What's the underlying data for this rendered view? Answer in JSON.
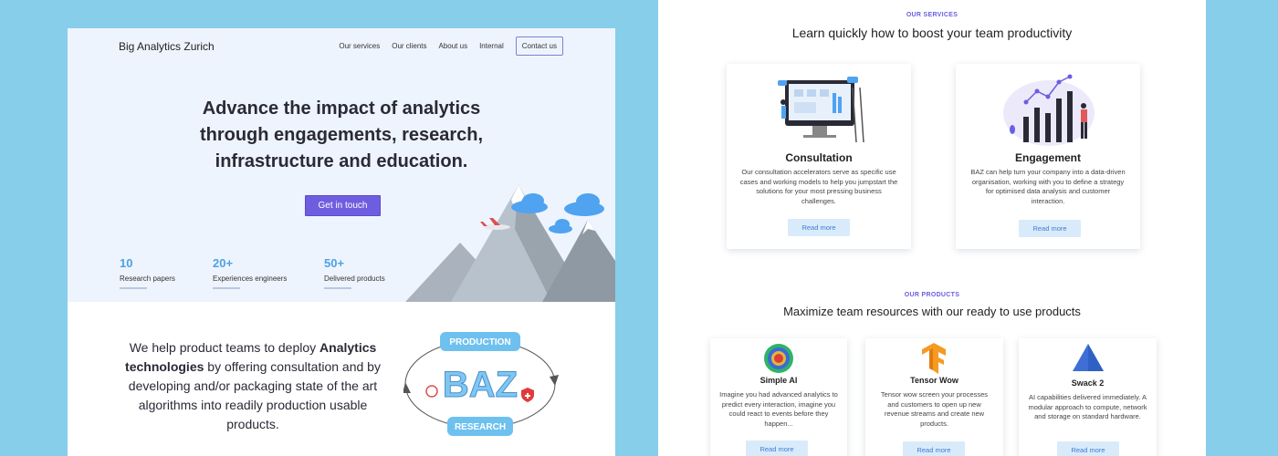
{
  "left_page": {
    "brand": "Big Analytics Zurich",
    "nav": {
      "services": "Our services",
      "clients": "Our clients",
      "about": "About us",
      "internal": "Internal",
      "contact": "Contact us"
    },
    "headline": {
      "line1": "Advance the impact of analytics",
      "line2": "through engagements, research,",
      "line3": "infrastructure and education."
    },
    "cta_label": "Get in touch",
    "stats": [
      {
        "value": "10",
        "label": "Research papers"
      },
      {
        "value": "20+",
        "label": "Experiences engineers"
      },
      {
        "value": "50+",
        "label": "Delivered products"
      }
    ],
    "intro": {
      "part1": "We help product teams to deploy",
      "bold": "Analytics technologies",
      "part2": "by offering consultation and by developing and/or packaging state of the art algorithms into readily production usable products."
    },
    "diagram": {
      "top": "PRODUCTION",
      "center": "BAZ",
      "bottom": "RESEARCH"
    }
  },
  "right_page": {
    "services": {
      "eyebrow": "OUR SERVICES",
      "title": "Learn quickly how to boost your team productivity",
      "cards": [
        {
          "title": "Consultation",
          "desc": "Our consultation accelerators serve as specific use cases and working models to help you jumpstart the solutions for your most pressing business challenges.",
          "button": "Read more"
        },
        {
          "title": "Engagement",
          "desc": "BAZ can help turn your company into a data-driven organisation, working with you to define a strategy for optimised data analysis and customer interaction.",
          "button": "Read more"
        }
      ]
    },
    "products": {
      "eyebrow": "OUR PRODUCTS",
      "title": "Maximize team resources with our ready to use products",
      "cards": [
        {
          "title": "Simple AI",
          "desc": "Imagine you had advanced analytics to predict every interaction, imagine you could react to events before they happen...",
          "button": "Read more"
        },
        {
          "title": "Tensor Wow",
          "desc": "Tensor wow screen your processes and customers to open up new revenue streams and create new products.",
          "button": "Read more"
        },
        {
          "title": "Swack 2",
          "desc": "AI capabilities delivered immediately. A modular approach to compute, network and storage on standard hardware.",
          "button": "Read more"
        }
      ]
    }
  },
  "colors": {
    "page_bg": "#87ceeb",
    "accent_purple": "#6f5de0",
    "stat_blue": "#4ca3e0",
    "hero_bg": "#eef4fd",
    "button_light": "#d9ebfa"
  }
}
